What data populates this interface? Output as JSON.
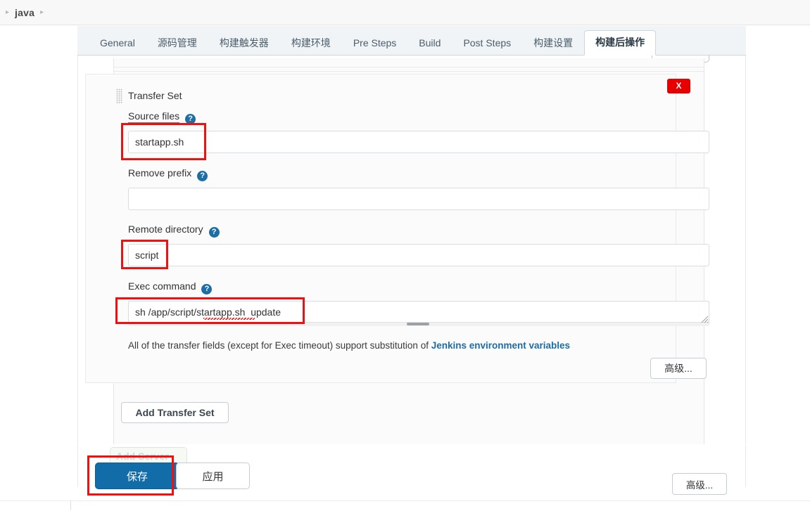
{
  "breadcrumb": {
    "leading_chevron": "▸",
    "item": "java",
    "trailing_chevron": "▸"
  },
  "tabs": [
    {
      "label": "General",
      "active": false
    },
    {
      "label": "源码管理",
      "active": false
    },
    {
      "label": "构建触发器",
      "active": false
    },
    {
      "label": "构建环境",
      "active": false
    },
    {
      "label": "Pre Steps",
      "active": false
    },
    {
      "label": "Build",
      "active": false
    },
    {
      "label": "Post Steps",
      "active": false
    },
    {
      "label": "构建设置",
      "active": false
    },
    {
      "label": "构建后操作",
      "active": true
    }
  ],
  "transfer_set": {
    "title": "Transfer Set",
    "delete_label": "X",
    "fields": {
      "source_files": {
        "label": "Source files",
        "help": "?",
        "value": "startapp.sh",
        "placeholder": ""
      },
      "remove_prefix": {
        "label": "Remove prefix",
        "help": "?",
        "value": "",
        "placeholder": ""
      },
      "remote_directory": {
        "label": "Remote directory",
        "help": "?",
        "value": "script",
        "placeholder": ""
      },
      "exec_command": {
        "label": "Exec command",
        "help": "?",
        "value": "sh /app/script/startapp.sh  update",
        "placeholder": ""
      }
    },
    "substitution_note_prefix": "All of the transfer fields (except for Exec timeout) support substitution of ",
    "substitution_link": "Jenkins environment variables",
    "advanced_label": "高级...",
    "add_transfer_set_label": "Add Transfer Set"
  },
  "server": {
    "add_server_label": "Add Server",
    "advanced_label": "高级..."
  },
  "footer": {
    "save_label": "保存",
    "apply_label": "应用"
  },
  "colors": {
    "accent_blue": "#126ca8",
    "link_blue": "#1b6ca8",
    "danger_red": "#e60000",
    "annotation_red": "#ee1111",
    "tab_bar_bg": "#f0f4f7"
  }
}
